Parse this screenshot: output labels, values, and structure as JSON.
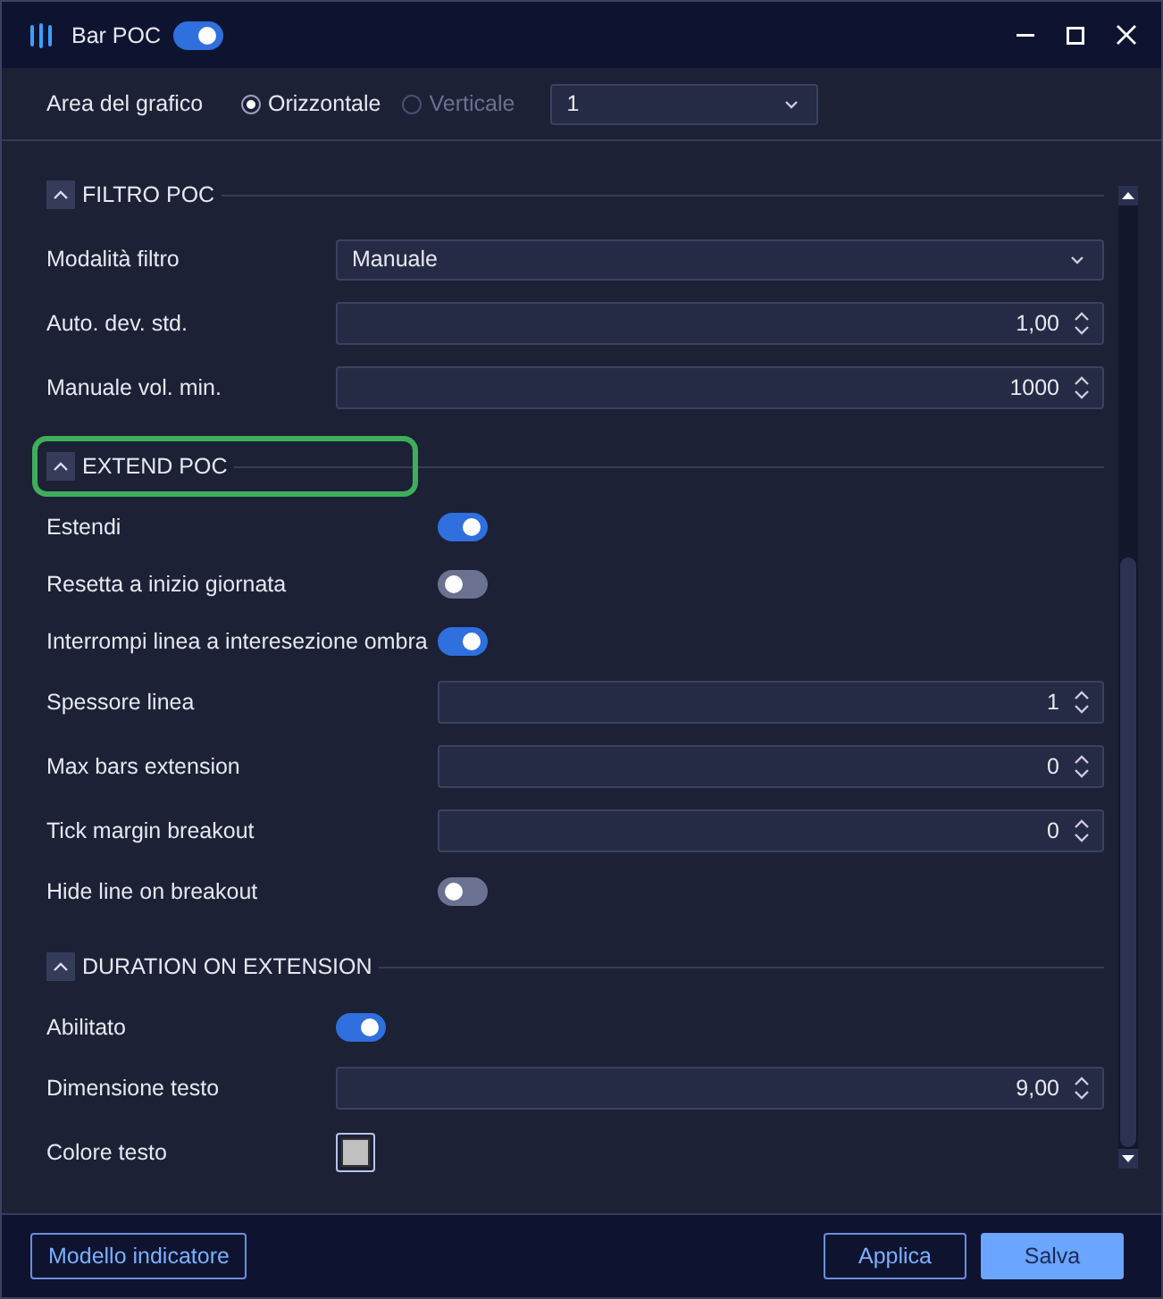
{
  "window": {
    "title": "Bar POC",
    "enabled": true
  },
  "chart_area": {
    "label": "Area del grafico",
    "options": [
      {
        "label": "Orizzontale",
        "selected": true,
        "disabled": false
      },
      {
        "label": "Verticale",
        "selected": false,
        "disabled": true
      }
    ],
    "panel": "1"
  },
  "sections": [
    {
      "title": "FILTRO POC",
      "expanded": true,
      "highlighted": false,
      "rows": [
        {
          "kind": "dropdown",
          "label": "Modalità filtro",
          "value": "Manuale"
        },
        {
          "kind": "spin",
          "label": "Auto. dev. std.",
          "value": "1,00"
        },
        {
          "kind": "spin",
          "label": "Manuale vol. min.",
          "value": "1000"
        }
      ]
    },
    {
      "title": "EXTEND POC",
      "expanded": true,
      "highlighted": true,
      "rows": [
        {
          "kind": "toggle",
          "label": "Estendi",
          "on": true
        },
        {
          "kind": "toggle",
          "label": "Resetta a inizio giornata",
          "on": false
        },
        {
          "kind": "toggle",
          "label": "Interrompi linea a interesezione ombra",
          "on": true
        },
        {
          "kind": "spin",
          "label": "Spessore linea",
          "value": "1"
        },
        {
          "kind": "spin",
          "label": "Max bars extension",
          "value": "0"
        },
        {
          "kind": "spin",
          "label": "Tick margin breakout",
          "value": "0"
        },
        {
          "kind": "toggle",
          "label": "Hide line on breakout",
          "on": false
        }
      ]
    },
    {
      "title": "DURATION ON EXTENSION",
      "expanded": true,
      "highlighted": false,
      "rows": [
        {
          "kind": "toggle",
          "label": "Abilitato",
          "on": true
        },
        {
          "kind": "spin",
          "label": "Dimensione testo",
          "value": "9,00"
        },
        {
          "kind": "color",
          "label": "Colore testo",
          "color": "#c0c0c0"
        }
      ]
    }
  ],
  "buttons": [
    {
      "label": "Modello indicatore",
      "kind": "outline"
    },
    {
      "label": "Applica",
      "kind": "outline"
    },
    {
      "label": "Salva",
      "kind": "primary"
    }
  ]
}
